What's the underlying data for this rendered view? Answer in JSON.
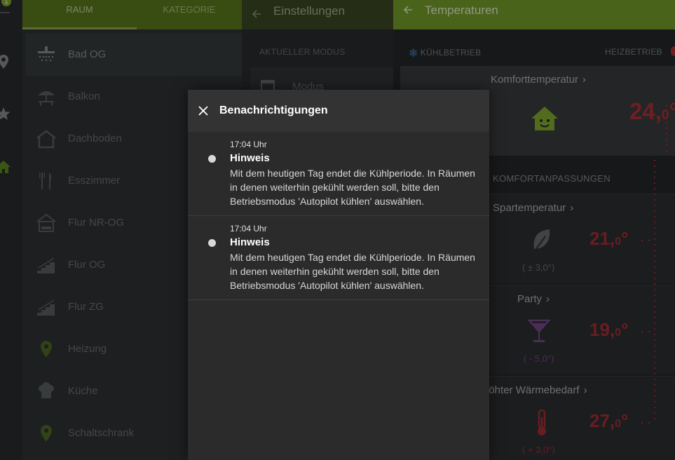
{
  "rail": {
    "badge": "1"
  },
  "rooms": {
    "tabs": [
      "RAUM",
      "KATEGORIE"
    ],
    "items": [
      {
        "label": "Bad OG",
        "icon": "shower-icon"
      },
      {
        "label": "Balkon",
        "icon": "parasol-icon"
      },
      {
        "label": "Dachboden",
        "icon": "attic-icon"
      },
      {
        "label": "Esszimmer",
        "icon": "cutlery-icon"
      },
      {
        "label": "Flur NR-OG",
        "icon": "hallway-icon"
      },
      {
        "label": "Flur OG",
        "icon": "stairs-icon"
      },
      {
        "label": "Flur ZG",
        "icon": "stairs-icon"
      },
      {
        "label": "Heizung",
        "icon": "location-pin-icon"
      },
      {
        "label": "Küche",
        "icon": "chef-hat-icon"
      },
      {
        "label": "Schaltschrank",
        "icon": "location-pin-icon"
      }
    ]
  },
  "settings": {
    "title": "Einstellungen",
    "section": "AKTUELLER MODUS",
    "mode_label": "Modus"
  },
  "temperatures": {
    "title": "Temperaturen",
    "mode_cool": "KÜHLBETRIEB",
    "mode_heat": "HEIZBETRIEB",
    "comfort": {
      "label": "Komforttemperatur",
      "value_int": "24,",
      "value_dec": "0",
      "unit": "°"
    },
    "adjust_section": "KOMFORTANPASSUNGEN",
    "adjustments": [
      {
        "label": "Spartemperatur",
        "value_int": "21,",
        "value_dec": "0",
        "unit": "°",
        "delta": "( ± 3,0°)",
        "icon": "leaf-icon"
      },
      {
        "label": "Party",
        "value_int": "19,",
        "value_dec": "0",
        "unit": "°",
        "delta": "( - 5,0°)",
        "icon": "cocktail-icon"
      },
      {
        "label": "höhter Wärmebedarf",
        "value_int": "27,",
        "value_dec": "0",
        "unit": "°",
        "delta": "( + 3,0°)",
        "icon": "thermometer-icon"
      }
    ]
  },
  "dialog": {
    "title": "Benachrichtigungen",
    "notifications": [
      {
        "time": "17:04 Uhr",
        "heading": "Hinweis",
        "message": "Mit dem heutigen Tag endet die Kühlperiode. In Räumen in denen weiterhin gekühlt werden soll, bitte den Betriebsmodus 'Autopilot kühlen' auswählen."
      },
      {
        "time": "17:04 Uhr",
        "heading": "Hinweis",
        "message": "Mit dem heutigen Tag endet die Kühlperiode. In Räumen in denen weiterhin gekühlt werden soll, bitte den Betriebsmodus 'Autopilot kühlen' auswählen."
      }
    ]
  },
  "colors": {
    "accent": "#78a02a",
    "temp_red": "#b0333a",
    "cool_blue": "#3f7ec6"
  }
}
